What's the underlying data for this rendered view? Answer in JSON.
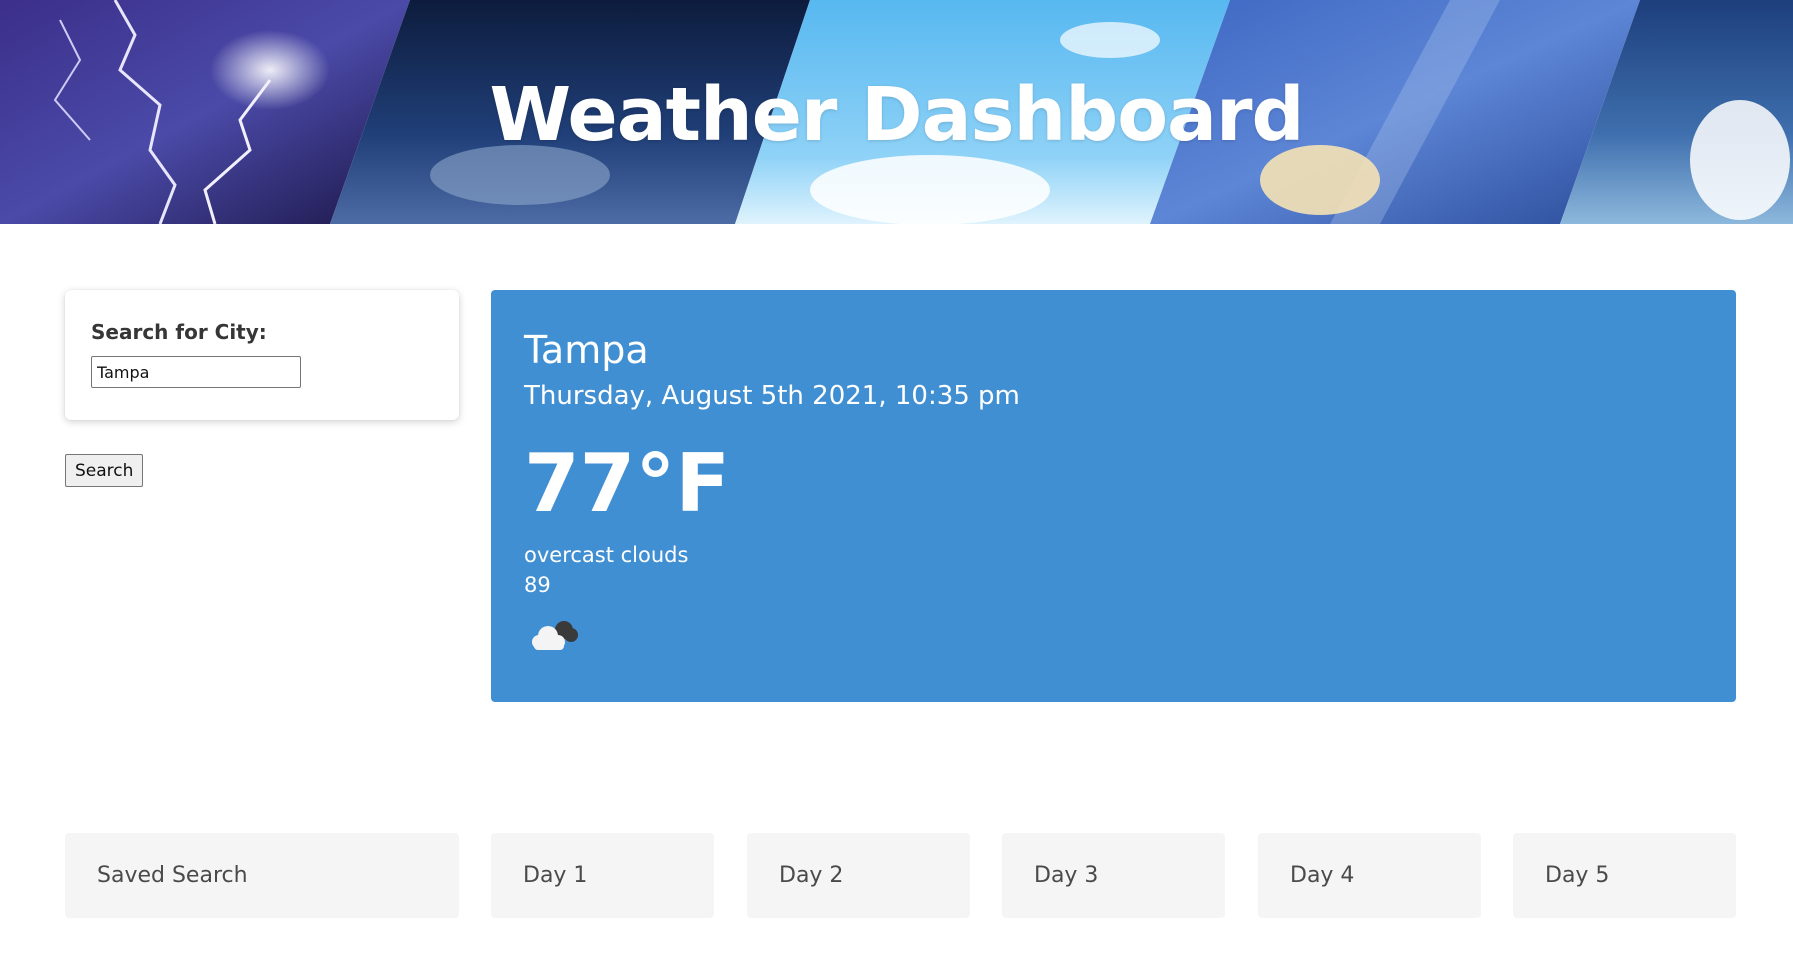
{
  "header": {
    "title": "Weather Dashboard"
  },
  "search": {
    "label": "Search for City:",
    "input_value": "Tampa",
    "button_label": "Search"
  },
  "current": {
    "city": "Tampa",
    "datetime": "Thursday, August 5th 2021, 10:35 pm",
    "temperature": "77°F",
    "description": "overcast clouds",
    "humidity": "89",
    "icon": "overcast-clouds-icon",
    "panel_color": "#418fd3"
  },
  "bottom": {
    "saved_label": "Saved Search",
    "days": [
      "Day 1",
      "Day 2",
      "Day 3",
      "Day 4",
      "Day 5"
    ]
  }
}
